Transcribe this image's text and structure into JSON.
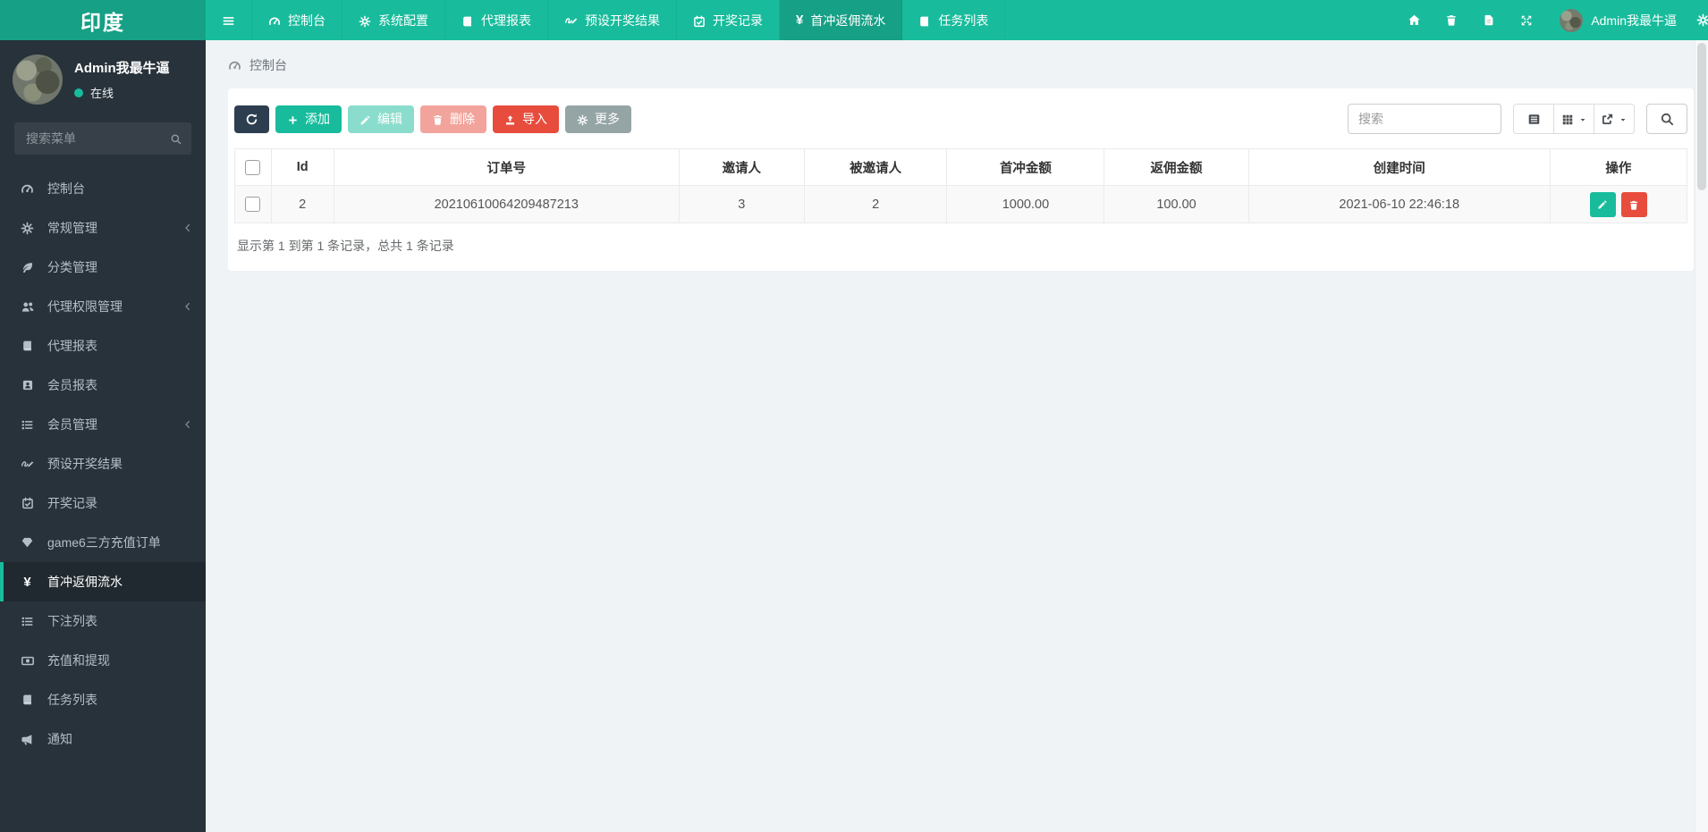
{
  "app": {
    "logo": "印度"
  },
  "topnav": {
    "tabs": [
      {
        "label": "控制台",
        "icon": "gauge-icon",
        "active": false
      },
      {
        "label": "系统配置",
        "icon": "gear-icon",
        "active": false
      },
      {
        "label": "代理报表",
        "icon": "book-icon",
        "active": false
      },
      {
        "label": "预设开奖结果",
        "icon": "pen-icon",
        "active": false
      },
      {
        "label": "开奖记录",
        "icon": "calendar-icon",
        "active": false
      },
      {
        "label": "首冲返佣流水",
        "icon": "yen-icon",
        "active": true
      },
      {
        "label": "任务列表",
        "icon": "book-icon",
        "active": false
      }
    ],
    "right_icons": [
      "home-icon",
      "trash-icon",
      "doc-icon",
      "expand-icon",
      "gear-icon"
    ],
    "user_name": "Admin我最牛逼"
  },
  "sidebar": {
    "user": {
      "name": "Admin我最牛逼",
      "status": "在线"
    },
    "search_placeholder": "搜索菜单",
    "items": [
      {
        "label": "控制台",
        "icon": "gauge-icon",
        "active": false,
        "has_children": false
      },
      {
        "label": "常规管理",
        "icon": "gear-icon",
        "active": false,
        "has_children": true
      },
      {
        "label": "分类管理",
        "icon": "leaf-icon",
        "active": false,
        "has_children": false
      },
      {
        "label": "代理权限管理",
        "icon": "users-icon",
        "active": false,
        "has_children": true
      },
      {
        "label": "代理报表",
        "icon": "book-icon",
        "active": false,
        "has_children": false
      },
      {
        "label": "会员报表",
        "icon": "id-card-icon",
        "active": false,
        "has_children": false
      },
      {
        "label": "会员管理",
        "icon": "list-icon",
        "active": false,
        "has_children": true
      },
      {
        "label": "预设开奖结果",
        "icon": "pen-icon",
        "active": false,
        "has_children": false
      },
      {
        "label": "开奖记录",
        "icon": "calendar-icon",
        "active": false,
        "has_children": false
      },
      {
        "label": "game6三方充值订单",
        "icon": "gem-icon",
        "active": false,
        "has_children": false
      },
      {
        "label": "首冲返佣流水",
        "icon": "yen-icon",
        "active": true,
        "has_children": false
      },
      {
        "label": "下注列表",
        "icon": "list-icon",
        "active": false,
        "has_children": false
      },
      {
        "label": "充值和提现",
        "icon": "money-icon",
        "active": false,
        "has_children": false
      },
      {
        "label": "任务列表",
        "icon": "book-icon",
        "active": false,
        "has_children": false
      },
      {
        "label": "通知",
        "icon": "bullhorn-icon",
        "active": false,
        "has_children": false
      }
    ]
  },
  "breadcrumb": {
    "label": "控制台",
    "icon": "gauge-icon"
  },
  "toolbar": {
    "add_label": "添加",
    "edit_label": "编辑",
    "delete_label": "删除",
    "import_label": "导入",
    "more_label": "更多",
    "search_placeholder": "搜索"
  },
  "table": {
    "columns": [
      "Id",
      "订单号",
      "邀请人",
      "被邀请人",
      "首冲金额",
      "返佣金额",
      "创建时间",
      "操作"
    ],
    "rows": [
      {
        "id": "2",
        "order_no": "20210610064209487213",
        "inviter": "3",
        "invitee": "2",
        "first_charge_amount": "1000.00",
        "rebate_amount": "100.00",
        "created_at": "2021-06-10 22:46:18"
      }
    ]
  },
  "footer": {
    "summary": "显示第 1 到第 1 条记录，总共 1 条记录"
  },
  "icons": {
    "yen_glyph": "¥"
  },
  "colors": {
    "header_teal": "#18bc9c",
    "header_dark_teal": "#16a086",
    "sidebar_bg": "#28323a",
    "btn_dark": "#2c3e50",
    "danger_red": "#e74c3c",
    "gray_btn": "#95a5a6",
    "content_bg": "#eff3f6"
  }
}
